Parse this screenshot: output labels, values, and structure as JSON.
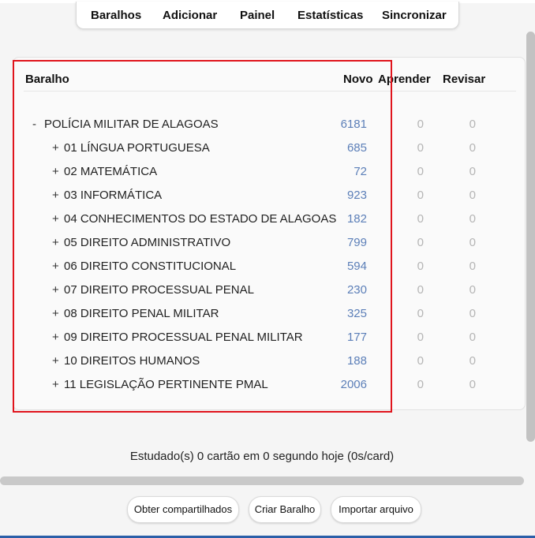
{
  "toolbar": {
    "decks": "Baralhos",
    "add": "Adicionar",
    "browse": "Painel",
    "stats": "Estatísticas",
    "sync": "Sincronizar"
  },
  "table": {
    "columns": {
      "deck": "Baralho",
      "new": "Novo",
      "learn": "Aprender",
      "review": "Revisar"
    },
    "rows": [
      {
        "toggle": "-",
        "name": "POLÍCIA MILITAR DE ALAGOAS",
        "new": "6181",
        "learn": "0",
        "review": "0"
      },
      {
        "toggle": "+",
        "name": "01 LÍNGUA PORTUGUESA",
        "new": "685",
        "learn": "0",
        "review": "0"
      },
      {
        "toggle": "+",
        "name": "02 MATEMÁTICA",
        "new": "72",
        "learn": "0",
        "review": "0"
      },
      {
        "toggle": "+",
        "name": "03 INFORMÁTICA",
        "new": "923",
        "learn": "0",
        "review": "0"
      },
      {
        "toggle": "+",
        "name": "04 CONHECIMENTOS DO ESTADO DE ALAGOAS",
        "new": "182",
        "learn": "0",
        "review": "0"
      },
      {
        "toggle": "+",
        "name": "05 DIREITO ADMINISTRATIVO",
        "new": "799",
        "learn": "0",
        "review": "0"
      },
      {
        "toggle": "+",
        "name": "06 DIREITO CONSTITUCIONAL",
        "new": "594",
        "learn": "0",
        "review": "0"
      },
      {
        "toggle": "+",
        "name": "07 DIREITO PROCESSUAL PENAL",
        "new": "230",
        "learn": "0",
        "review": "0"
      },
      {
        "toggle": "+",
        "name": "08 DIREITO PENAL MILITAR",
        "new": "325",
        "learn": "0",
        "review": "0"
      },
      {
        "toggle": "+",
        "name": "09 DIREITO PROCESSUAL PENAL MILITAR",
        "new": "177",
        "learn": "0",
        "review": "0"
      },
      {
        "toggle": "+",
        "name": "10 DIREITOS HUMANOS",
        "new": "188",
        "learn": "0",
        "review": "0"
      },
      {
        "toggle": "+",
        "name": "11 LEGISLAÇÃO PERTINENTE PMAL",
        "new": "2006",
        "learn": "0",
        "review": "0"
      }
    ]
  },
  "status": {
    "studied": "Estudado(s) 0 cartão em 0 segundo hoje (0s/card)"
  },
  "buttons": {
    "shared": "Obter compartilhados",
    "create": "Criar Baralho",
    "import": "Importar arquivo"
  },
  "colors": {
    "new_count": "#5c7fb8",
    "zero_count": "#b5b5b5",
    "highlight_box": "#e0141c",
    "accent_line": "#2b5fa8"
  }
}
